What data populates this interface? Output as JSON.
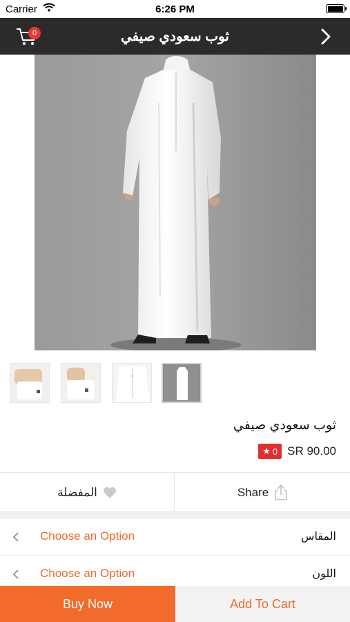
{
  "status_bar": {
    "carrier": "Carrier",
    "time": "6:26 PM"
  },
  "navbar": {
    "title": "ثوب سعودي صيفي",
    "cart_count": "0"
  },
  "product": {
    "name": "ثوب سعودي صيفي",
    "price": "SR 90.00",
    "rating": "0"
  },
  "actions": {
    "favorite_label": "المفضلة",
    "share_label": "Share"
  },
  "options": [
    {
      "label": "المقاس",
      "value": "Choose an Option"
    },
    {
      "label": "اللون",
      "value": "Choose an Option"
    }
  ],
  "bottom": {
    "buy_now": "Buy Now",
    "add_to_cart": "Add To Cart"
  },
  "colors": {
    "accent": "#f26b2b",
    "nav_bg": "#2b2b2b",
    "badge": "#e53935"
  }
}
